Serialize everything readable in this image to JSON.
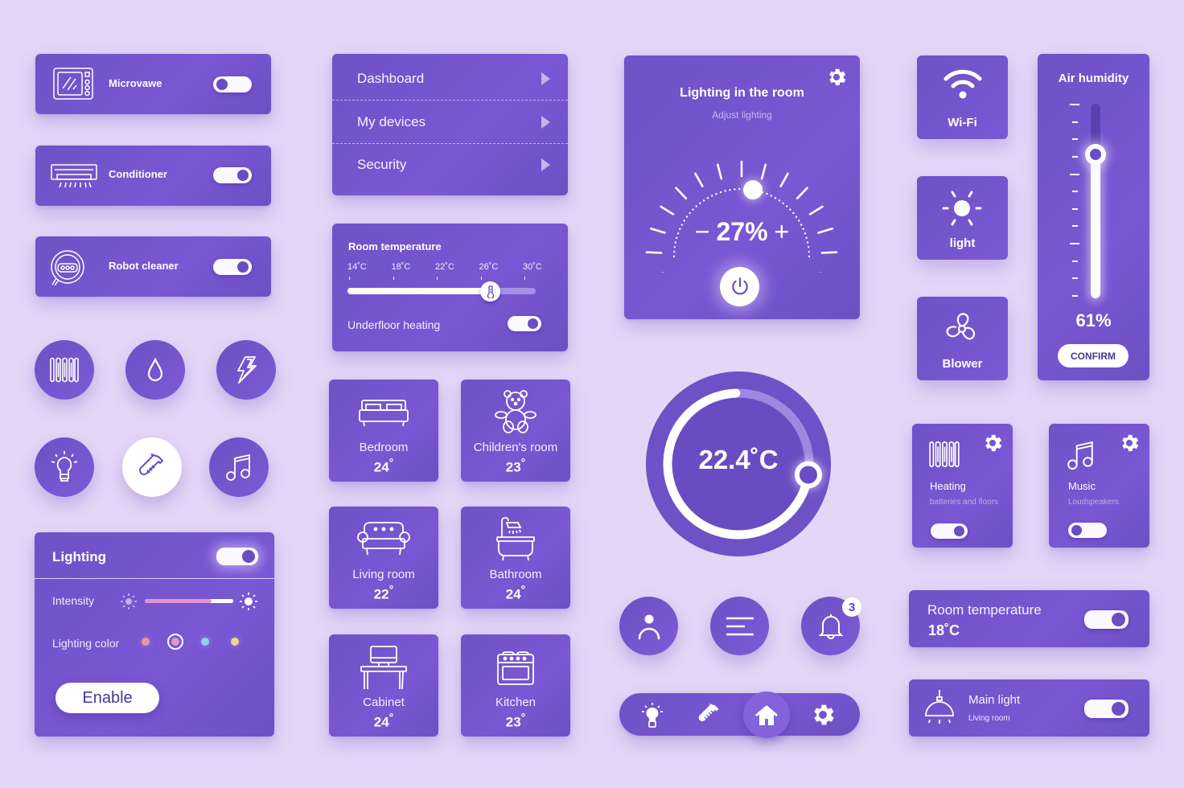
{
  "colors": {
    "background": "#e4d6f7",
    "card": "#7052c9",
    "accent_dark": "#6a4cc4",
    "white": "#ffffff"
  },
  "devices": [
    {
      "label": "Microvawe",
      "icon": "microwave-icon",
      "toggle": false
    },
    {
      "label": "Conditioner",
      "icon": "air-conditioner-icon",
      "toggle": true
    },
    {
      "label": "Robot cleaner",
      "icon": "robot-cleaner-icon",
      "toggle": true
    }
  ],
  "round_buttons": [
    {
      "icon": "radiator-icon",
      "active": false
    },
    {
      "icon": "water-drop-icon",
      "active": false
    },
    {
      "icon": "lightning-icon",
      "active": false
    },
    {
      "icon": "light-bulb-icon",
      "active": false
    },
    {
      "icon": "thermometer-icon",
      "active": true
    },
    {
      "icon": "music-note-icon",
      "active": false
    }
  ],
  "lighting_panel": {
    "title": "Lighting",
    "toggle": true,
    "intensity_label": "Intensity",
    "intensity_percent": 75,
    "color_label": "Lighting color",
    "colors": [
      "#e59a98",
      "#d99ad3",
      "#8fd0f4",
      "#ead98a"
    ],
    "selected_color_index": 1,
    "enable_button": "Enable"
  },
  "nav_menu": {
    "items": [
      {
        "label": "Dashboard"
      },
      {
        "label": "My devices"
      },
      {
        "label": "Security"
      }
    ]
  },
  "room_temp_slider": {
    "title": "Room temperature",
    "ticks": [
      "14˚C",
      "18˚C",
      "22˚C",
      "26˚C",
      "30˚C"
    ],
    "value_celsius": 27,
    "range": [
      14,
      30
    ],
    "underfloor_label": "Underfloor heating",
    "underfloor_toggle": true
  },
  "rooms": [
    {
      "name": "Bedroom",
      "temp": "24",
      "icon": "bed-icon"
    },
    {
      "name": "Children's room",
      "temp": "23",
      "icon": "teddy-bear-icon"
    },
    {
      "name": "Living room",
      "temp": "22",
      "icon": "sofa-icon"
    },
    {
      "name": "Bathroom",
      "temp": "24",
      "icon": "bathtub-icon"
    },
    {
      "name": "Cabinet",
      "temp": "24",
      "icon": "desk-computer-icon"
    },
    {
      "name": "Kitchen",
      "temp": "23",
      "icon": "stove-icon"
    }
  ],
  "degree_symbol": "°",
  "lighting_room": {
    "title": "Lighting in the room",
    "subtitle": "Adjust lighting",
    "value": "27%",
    "minus": "−",
    "plus": "+",
    "percent": 27
  },
  "thermostat": {
    "value": "22.4",
    "unit": "˚C",
    "progress_fraction": 0.72
  },
  "action_buttons": [
    {
      "icon": "user-icon"
    },
    {
      "icon": "menu-icon"
    },
    {
      "icon": "bell-icon",
      "badge": "3"
    }
  ],
  "bottom_nav": [
    {
      "icon": "light-bulb-icon"
    },
    {
      "icon": "thermometer-icon"
    },
    {
      "icon": "home-icon",
      "active": true
    },
    {
      "icon": "gear-icon"
    }
  ],
  "quick_tiles": [
    {
      "label": "Wi-Fi",
      "icon": "wifi-icon"
    },
    {
      "label": "light",
      "icon": "sun-icon"
    },
    {
      "label": "Blower",
      "icon": "fan-icon"
    }
  ],
  "humidity": {
    "title": "Air humidity",
    "value": "61%",
    "percent": 61,
    "confirm": "CONFIRM"
  },
  "feature_cards": [
    {
      "title": "Heating",
      "subtitle": "batteries and floors",
      "toggle": true,
      "icon": "radiator-icon"
    },
    {
      "title": "Music",
      "subtitle": "Loudspeakers",
      "toggle": false,
      "icon": "music-note-icon"
    }
  ],
  "room_temp_card": {
    "title": "Room temperature",
    "value": "18˚C",
    "toggle": true
  },
  "main_light": {
    "title": "Main light",
    "subtitle": "Living room",
    "toggle": true
  }
}
